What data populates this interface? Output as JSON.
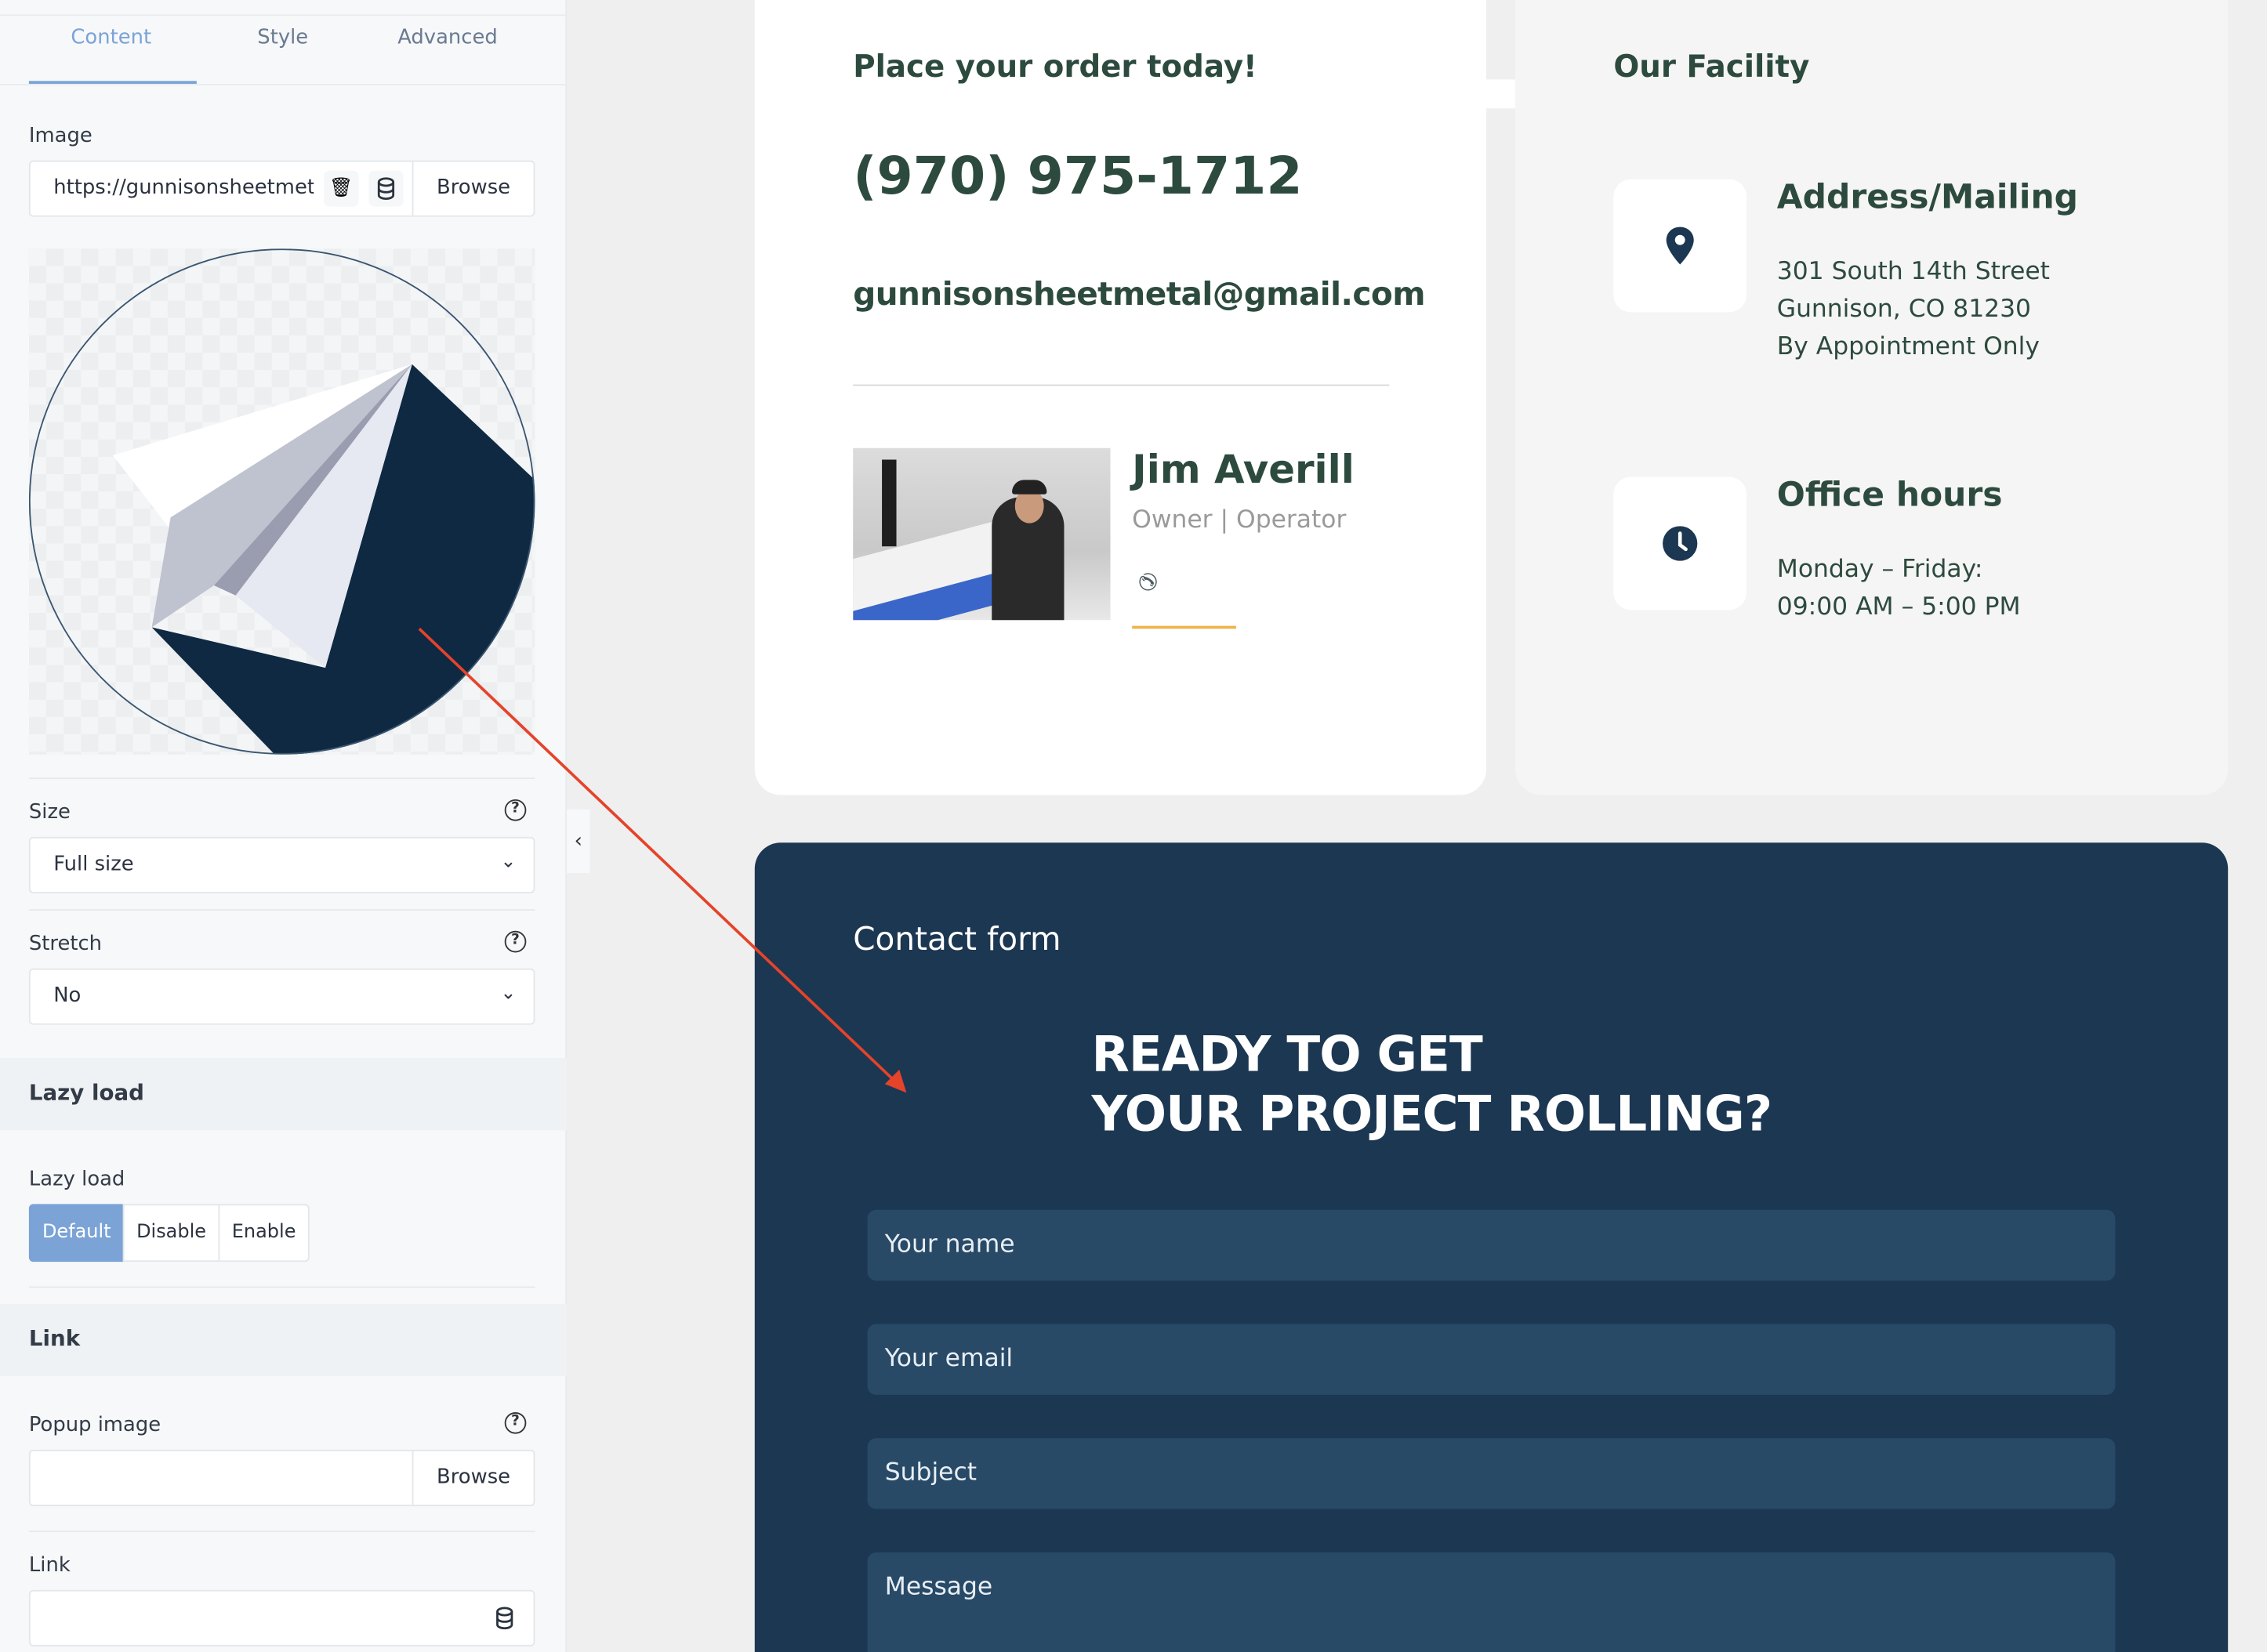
{
  "panel": {
    "tabs": [
      {
        "label": "Content",
        "active": true
      },
      {
        "label": "Style"
      },
      {
        "label": "Advanced"
      }
    ],
    "image": {
      "label": "Image",
      "value": "https://gunnisonsheetmetal",
      "browse": "Browse"
    },
    "size": {
      "label": "Size",
      "value": "Full size"
    },
    "stretch": {
      "label": "Stretch",
      "value": "No"
    },
    "lazy_section": "Lazy load",
    "lazy": {
      "label": "Lazy load",
      "options": [
        "Default",
        "Disable",
        "Enable"
      ],
      "selected": "Default"
    },
    "link_section": "Link",
    "popup": {
      "label": "Popup image",
      "value": "",
      "browse": "Browse"
    },
    "link": {
      "label": "Link",
      "value": ""
    },
    "help_glyph": "?",
    "collapse_glyph": "‹",
    "accent": "#7ba3d6"
  },
  "order": {
    "title": "Place your order today!",
    "phone": "(970) 975-1712",
    "email": "gunnisonsheetmetal@gmail.com",
    "person": {
      "name": "Jim Averill",
      "role": "Owner | Operator"
    }
  },
  "facility": {
    "title": "Our Facility",
    "address": {
      "heading": "Address/Mailing",
      "lines": [
        "301 South 14th Street",
        "Gunnison, CO 81230",
        "By Appointment Only"
      ]
    },
    "hours": {
      "heading": "Office hours",
      "lines": [
        "Monday – Friday:",
        "09:00 AM – 5:00 PM"
      ]
    }
  },
  "contact": {
    "title": "Contact form",
    "heading1": "READY TO GET",
    "heading2": "YOUR PROJECT ROLLING?",
    "fields": [
      "Your name",
      "Your email",
      "Subject",
      "Message"
    ],
    "bg": "#1c3752"
  },
  "colors": {
    "heading_green": "#2d4a3e",
    "underline": "#f0b44c",
    "arrow": "#e5432a"
  }
}
